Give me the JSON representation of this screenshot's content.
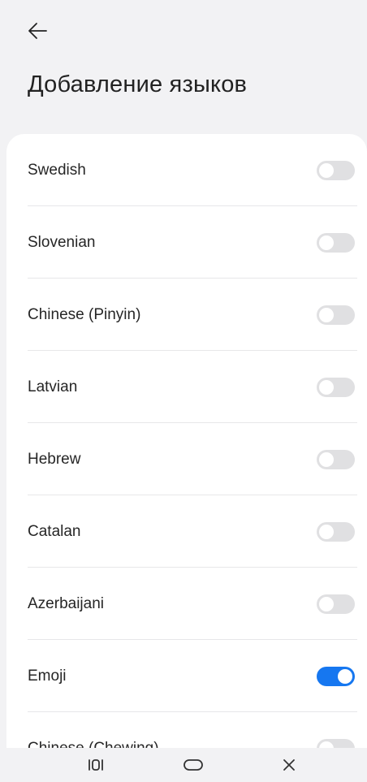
{
  "header": {
    "back_icon": "arrow-left-icon",
    "title": "Добавление языков"
  },
  "languages": [
    {
      "label": "Swedish",
      "enabled": false
    },
    {
      "label": "Slovenian",
      "enabled": false
    },
    {
      "label": "Chinese (Pinyin)",
      "enabled": false
    },
    {
      "label": "Latvian",
      "enabled": false
    },
    {
      "label": "Hebrew",
      "enabled": false
    },
    {
      "label": "Catalan",
      "enabled": false
    },
    {
      "label": "Azerbaijani",
      "enabled": false
    },
    {
      "label": "Emoji",
      "enabled": true
    },
    {
      "label": "Chinese (Chewing)",
      "enabled": false
    }
  ],
  "navbar": {
    "recents_icon": "recents-icon",
    "home_icon": "home-icon",
    "back_icon": "close-icon"
  },
  "colors": {
    "accent": "#1677f0",
    "toggle_off": "#e0e0e2",
    "background": "#f2f2f4"
  }
}
